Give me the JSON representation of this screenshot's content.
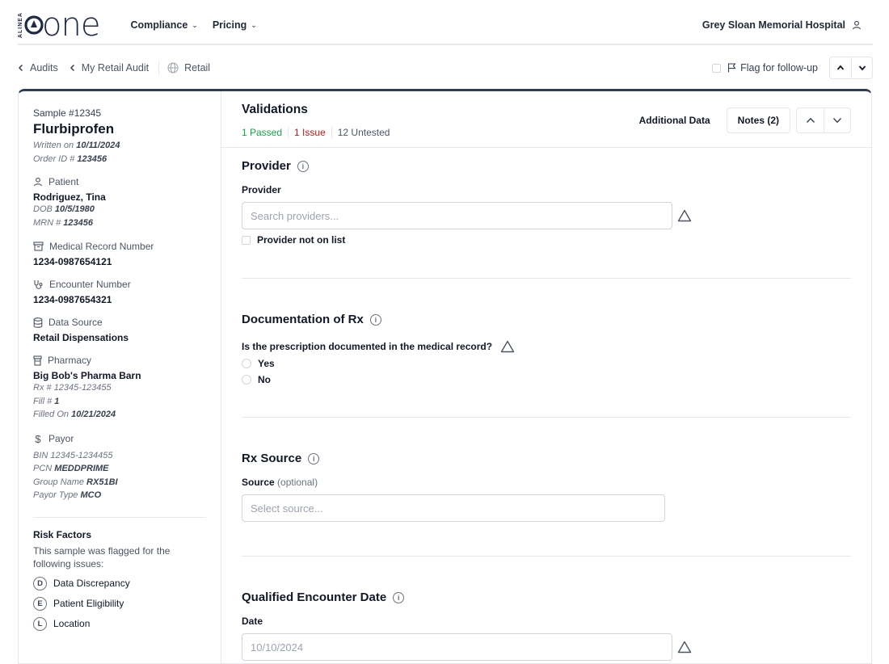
{
  "brand": {
    "tag": "ALINEA",
    "name": "one"
  },
  "nav": {
    "items": [
      {
        "label": "Compliance"
      },
      {
        "label": "Pricing"
      }
    ],
    "org_name": "Grey Sloan Memorial Hospital"
  },
  "breadcrumb": {
    "audits": "Audits",
    "audit_name": "My Retail Audit",
    "channel": "Retail",
    "flag_label": "Flag for follow-up"
  },
  "sample": {
    "number": "Sample #12345",
    "drug": "Flurbiprofen",
    "written_prefix": "Written on",
    "written_on": "10/11/2024",
    "order_prefix": "Order ID #",
    "order_id": "123456"
  },
  "patient": {
    "heading": "Patient",
    "name": "Rodriguez, Tina",
    "dob_prefix": "DOB",
    "dob": "10/5/1980",
    "mrn_prefix": "MRN #",
    "mrn": "123456"
  },
  "medical_record": {
    "heading": "Medical Record Number",
    "value": "1234-0987654121"
  },
  "encounter": {
    "heading": "Encounter Number",
    "value": "1234-0987654321"
  },
  "data_source": {
    "heading": "Data Source",
    "value": "Retail Dispensations"
  },
  "pharmacy": {
    "heading": "Pharmacy",
    "name": "Big Bob's Pharma Barn",
    "rx_prefix": "Rx #",
    "rx": "12345-123455",
    "fill_prefix": "Fill #",
    "fill": "1",
    "filled_prefix": "Filled On",
    "filled_on": "10/21/2024"
  },
  "payor": {
    "heading": "Payor",
    "bin_prefix": "BIN",
    "bin": "12345-1234455",
    "pcn_prefix": "PCN",
    "pcn": "MEDDPRIME",
    "group_prefix": "Group Name",
    "group": "RX51BI",
    "type_prefix": "Payor Type",
    "type": "MCO"
  },
  "risk": {
    "title": "Risk Factors",
    "description": "This sample was flagged for the following issues:",
    "items": [
      {
        "letter": "D",
        "label": "Data Discrepancy"
      },
      {
        "letter": "E",
        "label": "Patient Eligibility"
      },
      {
        "letter": "L",
        "label": "Location"
      }
    ]
  },
  "validations": {
    "title": "Validations",
    "passed": "1 Passed",
    "issue": "1 Issue",
    "untested": "12 Untested",
    "additional_data": "Additional Data",
    "notes": "Notes (2)"
  },
  "provider": {
    "title": "Provider",
    "field_label": "Provider",
    "placeholder": "Search providers...",
    "not_on_list": "Provider not on list"
  },
  "documentation": {
    "title": "Documentation of Rx",
    "question": "Is the prescription documented in the medical record?",
    "options": [
      "Yes",
      "No"
    ]
  },
  "rx_source": {
    "title": "Rx Source",
    "field_label": "Source",
    "optional": "(optional)",
    "placeholder": "Select source..."
  },
  "encounter_date": {
    "title": "Qualified Encounter Date",
    "field_label": "Date",
    "placeholder": "10/10/2024"
  }
}
